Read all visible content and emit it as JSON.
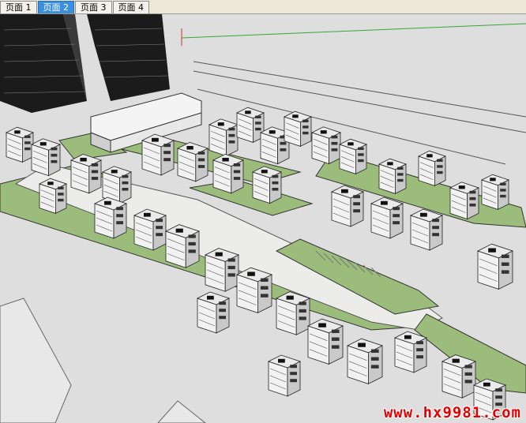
{
  "tabs": [
    {
      "label": "页面 1",
      "active": false
    },
    {
      "label": "页面 2",
      "active": true
    },
    {
      "label": "页面 3",
      "active": false
    },
    {
      "label": "页面 4",
      "active": false
    }
  ],
  "watermark": "www.hx9981.com",
  "colors": {
    "sky": "#dcdcdc",
    "ground": "#e4e4e0",
    "grass": "#9cbc7c",
    "road": "#e6e6e2",
    "building": "#f2f2f2",
    "building_shade": "#c8c8c8",
    "roof_dark": "#111111",
    "green_axis": "#33aa33",
    "watermark": "#e60000"
  }
}
